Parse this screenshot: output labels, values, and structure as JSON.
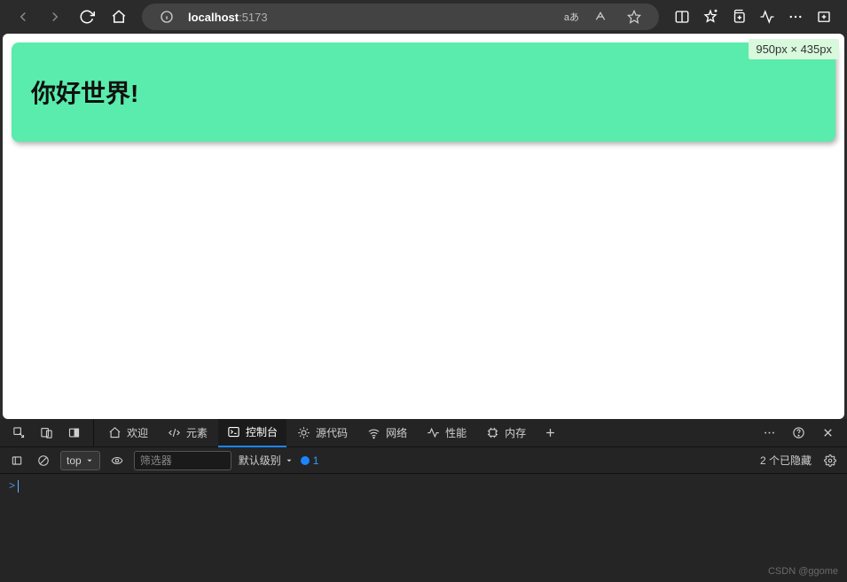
{
  "browser": {
    "url_host": "localhost",
    "url_port": ":5173",
    "lang_label": "aあ"
  },
  "page": {
    "dimension_badge": "950px × 435px",
    "hello_text": "你好世界!"
  },
  "devtools": {
    "tabs": {
      "welcome": "欢迎",
      "elements": "元素",
      "console": "控制台",
      "sources": "源代码",
      "network": "网络",
      "performance": "性能",
      "memory": "内存"
    },
    "toolbar": {
      "context": "top",
      "filter_placeholder": "筛选器",
      "level": "默认级别",
      "issues_count": "1",
      "hidden_text": "2 个已隐藏"
    },
    "prompt": ">",
    "watermark": "CSDN @ggome"
  }
}
